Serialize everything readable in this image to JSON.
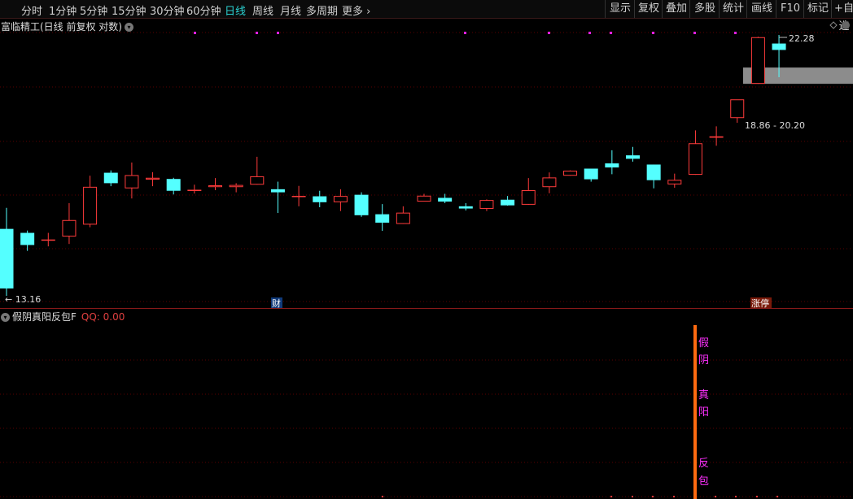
{
  "toolbar": {
    "periods": [
      {
        "label": "分时",
        "active": false
      },
      {
        "label": "1分钟",
        "active": false
      },
      {
        "label": "5分钟",
        "active": false
      },
      {
        "label": "15分钟",
        "active": false
      },
      {
        "label": "30分钟",
        "active": false
      },
      {
        "label": "60分钟",
        "active": false
      },
      {
        "label": "日线",
        "active": true
      },
      {
        "label": "周线",
        "active": false
      },
      {
        "label": "月线",
        "active": false
      },
      {
        "label": "多周期",
        "active": false
      }
    ],
    "more_label": "更多",
    "more_icon": "›",
    "right_buttons": [
      "显示",
      "复权",
      "叠加",
      "多股",
      "统计",
      "画线",
      "F10",
      "标记",
      "+自选"
    ]
  },
  "main_chart": {
    "title": "富临精工(日线 前复权 对数)",
    "max_label": "22.28",
    "min_label": "13.16",
    "range_label": "18.86 - 20.20",
    "finance_marker": "财",
    "limit_up_marker": "涨停",
    "colors": {
      "up": "#ff3b3b",
      "down": "#54ffff",
      "grid": "#5a0000",
      "dot": "#e020e0",
      "gap": "#8c8c8c"
    }
  },
  "sub_chart": {
    "title": "假阴真阳反包F",
    "qq_label": "QQ: 0.00",
    "signal_chars": [
      "假",
      "阴",
      "真",
      "阳",
      "反",
      "包"
    ],
    "colors": {
      "signal_bar": "#ff6a10",
      "signal_text": "#ff30ff"
    }
  },
  "chart_data": {
    "type": "candlestick",
    "title": "富临精工(日线 前复权 对数)",
    "scale": "log",
    "ylim": [
      13.16,
      22.28
    ],
    "candles": [
      {
        "o": 15.1,
        "h": 15.75,
        "l": 13.2,
        "c": 13.4
      },
      {
        "o": 14.98,
        "h": 15.05,
        "l": 14.45,
        "c": 14.62
      },
      {
        "o": 14.76,
        "h": 14.98,
        "l": 14.58,
        "c": 14.78
      },
      {
        "o": 14.87,
        "h": 15.9,
        "l": 14.65,
        "c": 15.37
      },
      {
        "o": 15.23,
        "h": 16.8,
        "l": 15.15,
        "c": 16.43
      },
      {
        "o": 16.9,
        "h": 16.98,
        "l": 16.45,
        "c": 16.55
      },
      {
        "o": 16.38,
        "h": 17.25,
        "l": 16.05,
        "c": 16.82
      },
      {
        "o": 16.67,
        "h": 16.92,
        "l": 16.45,
        "c": 16.73
      },
      {
        "o": 16.69,
        "h": 16.73,
        "l": 16.18,
        "c": 16.3
      },
      {
        "o": 16.32,
        "h": 16.5,
        "l": 16.21,
        "c": 16.32
      },
      {
        "o": 16.42,
        "h": 16.72,
        "l": 16.32,
        "c": 16.48
      },
      {
        "o": 16.42,
        "h": 16.55,
        "l": 16.25,
        "c": 16.49
      },
      {
        "o": 16.5,
        "h": 17.45,
        "l": 16.5,
        "c": 16.78
      },
      {
        "o": 16.35,
        "h": 16.6,
        "l": 15.59,
        "c": 16.25
      },
      {
        "o": 16.12,
        "h": 16.46,
        "l": 15.8,
        "c": 16.12
      },
      {
        "o": 16.12,
        "h": 16.3,
        "l": 15.77,
        "c": 15.93
      },
      {
        "o": 15.93,
        "h": 16.35,
        "l": 15.65,
        "c": 16.13
      },
      {
        "o": 16.17,
        "h": 16.25,
        "l": 15.47,
        "c": 15.52
      },
      {
        "o": 15.55,
        "h": 15.87,
        "l": 15.04,
        "c": 15.29
      },
      {
        "o": 15.25,
        "h": 15.8,
        "l": 15.25,
        "c": 15.6
      },
      {
        "o": 15.95,
        "h": 16.2,
        "l": 15.95,
        "c": 16.14
      },
      {
        "o": 16.07,
        "h": 16.2,
        "l": 15.9,
        "c": 15.95
      },
      {
        "o": 15.8,
        "h": 15.9,
        "l": 15.67,
        "c": 15.73
      },
      {
        "o": 15.72,
        "h": 16.02,
        "l": 15.65,
        "c": 16.0
      },
      {
        "o": 16.01,
        "h": 16.13,
        "l": 15.82,
        "c": 15.83
      },
      {
        "o": 15.85,
        "h": 16.72,
        "l": 15.85,
        "c": 16.32
      },
      {
        "o": 16.42,
        "h": 16.91,
        "l": 16.22,
        "c": 16.74
      },
      {
        "o": 16.8,
        "h": 16.98,
        "l": 16.8,
        "c": 16.97
      },
      {
        "o": 17.04,
        "h": 17.04,
        "l": 16.6,
        "c": 16.68
      },
      {
        "o": 17.22,
        "h": 17.68,
        "l": 16.85,
        "c": 17.08
      },
      {
        "o": 17.5,
        "h": 17.8,
        "l": 17.28,
        "c": 17.38
      },
      {
        "o": 17.18,
        "h": 17.18,
        "l": 16.38,
        "c": 16.65
      },
      {
        "o": 16.51,
        "h": 16.87,
        "l": 16.4,
        "c": 16.66
      },
      {
        "o": 16.83,
        "h": 18.4,
        "l": 16.83,
        "c": 17.93
      },
      {
        "o": 18.13,
        "h": 18.55,
        "l": 17.84,
        "c": 18.18
      },
      {
        "o": 18.86,
        "h": 19.45,
        "l": 18.68,
        "c": 19.58
      },
      {
        "o": 20.2,
        "h": 22.2,
        "l": 20.2,
        "c": 22.18
      },
      {
        "o": 21.9,
        "h": 22.28,
        "l": 20.47,
        "c": 21.62
      }
    ],
    "gap": {
      "low": 20.2,
      "high": 20.87
    },
    "indicator": {
      "name": "假阴真阳反包F",
      "QQ": 0.0
    }
  }
}
